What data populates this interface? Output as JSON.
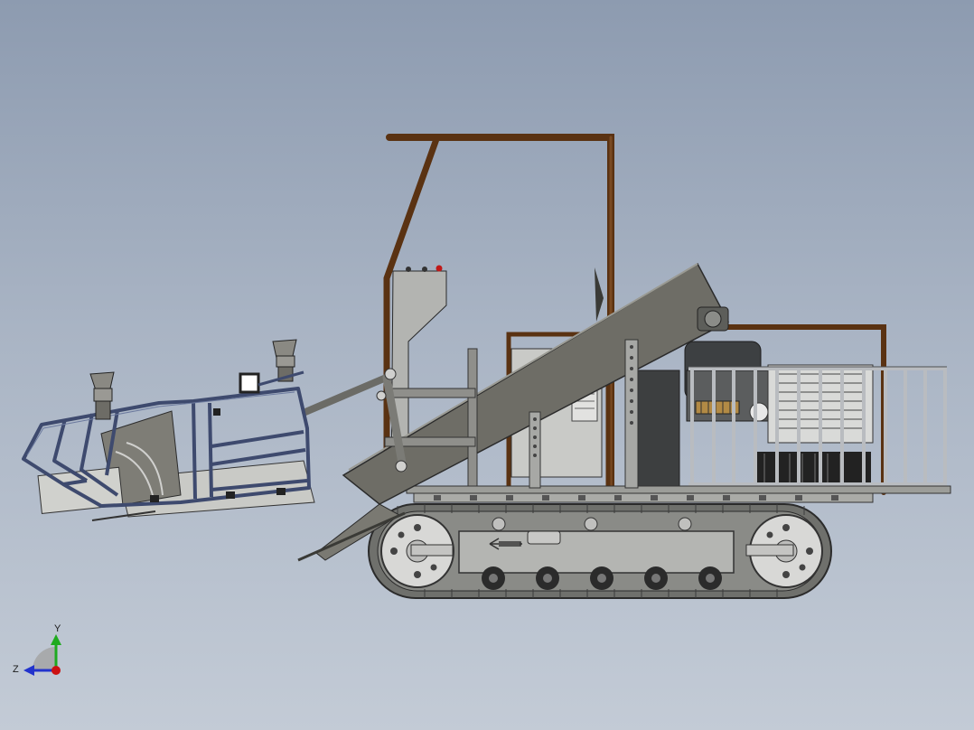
{
  "viewport": {
    "background_top": "#8d9bb0",
    "background_bottom": "#c3cbd6"
  },
  "model": {
    "frame_color": "#5a3212",
    "steel_color": "#7b7a72",
    "track_color": "#6f706c",
    "cage_color": "#cfd2d6",
    "track_arrow_icon": "left-arrow"
  },
  "triad": {
    "y_label": "Y",
    "z_label": "Z",
    "y_color": "#1faa1f",
    "z_color": "#2233cc",
    "origin_color": "#cc1111"
  }
}
